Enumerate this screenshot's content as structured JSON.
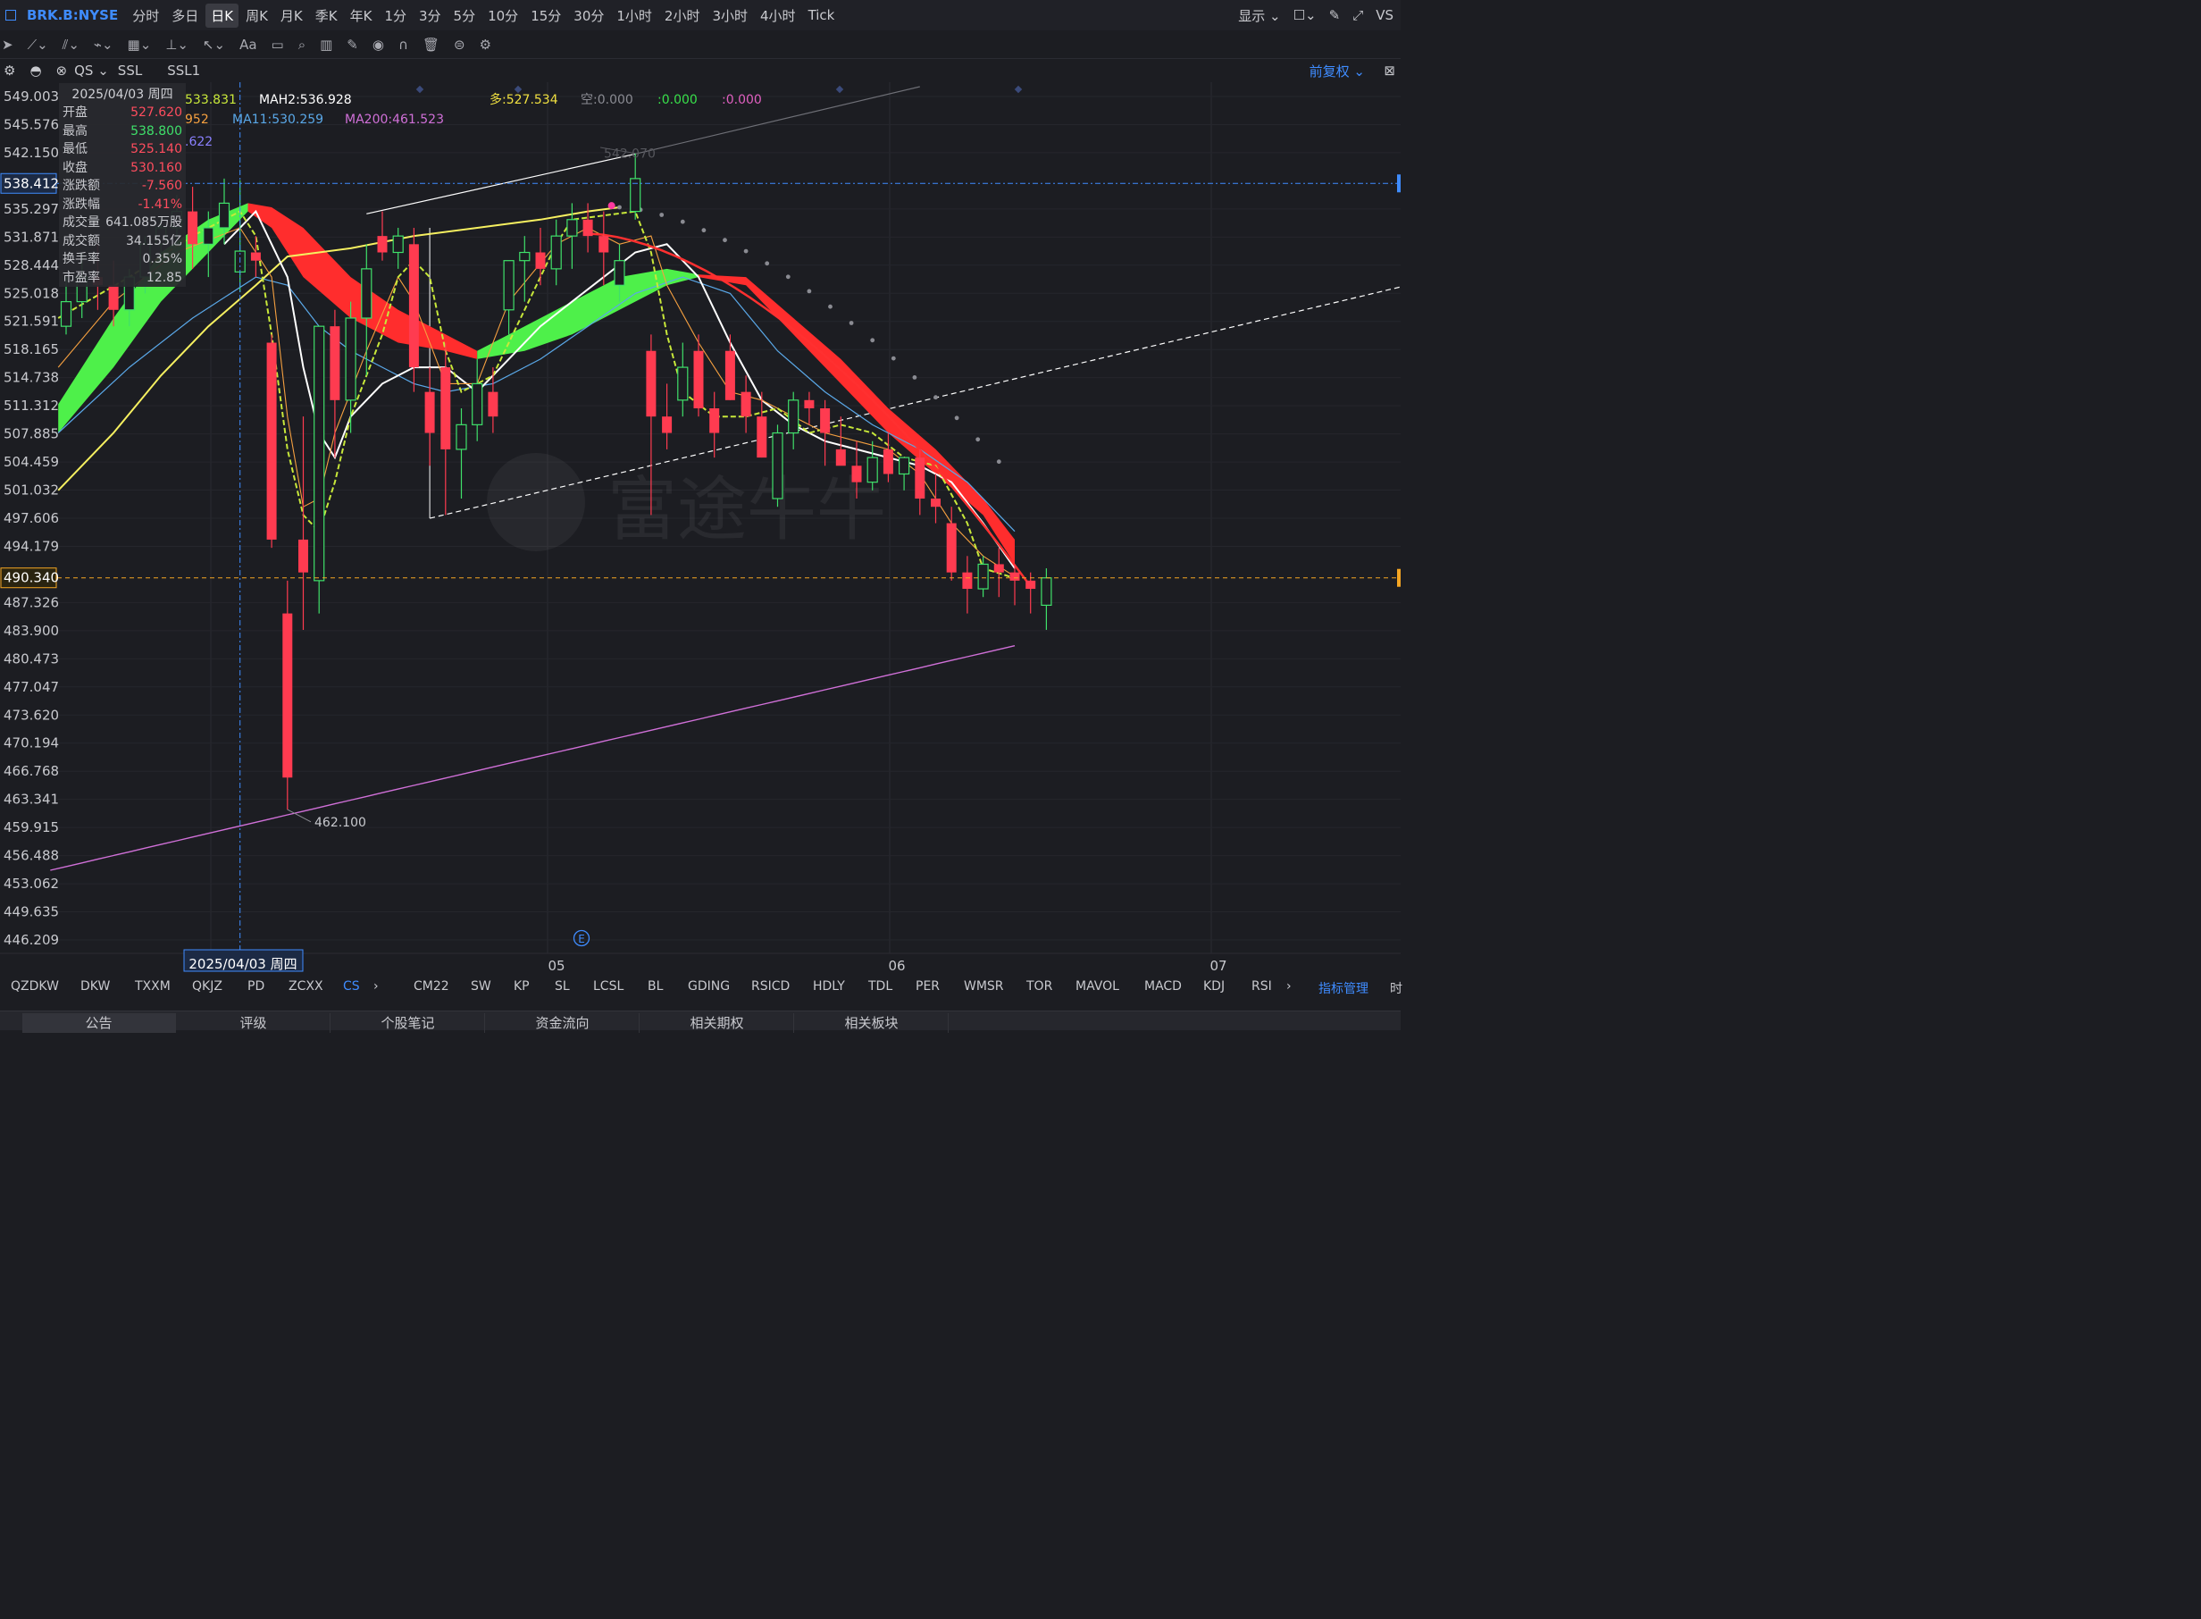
{
  "header": {
    "symbol": "BRK.B:NYSE",
    "periods": [
      "分时",
      "多日",
      "日K",
      "周K",
      "月K",
      "季K",
      "年K",
      "1分",
      "3分",
      "5分",
      "10分",
      "15分",
      "30分",
      "1小时",
      "2小时",
      "3小时",
      "4小时",
      "Tick"
    ],
    "active_period": "日K",
    "display_label": "显示",
    "vs_label": "VS"
  },
  "toolbar": {
    "text_tool": "Aa"
  },
  "indicator_bar": {
    "qs": "QS",
    "ssl": "SSL",
    "ssl1": "SSL1",
    "adjust": "前复权"
  },
  "legend": {
    "line1": [
      {
        "text": "533.831",
        "color": "#c8e83a"
      },
      {
        "text": "MAH2:536.928",
        "color": "#ffffff"
      },
      {
        "text": "多:527.534",
        "color": "#f0e040"
      },
      {
        "text": "空:0.000",
        "color": "#8a8b92"
      },
      {
        "text": ":0.000",
        "color": "#38e04a"
      },
      {
        "text": ":0.000",
        "color": "#e060c0"
      }
    ],
    "line2": [
      {
        "text": "952",
        "color": "#f5a040"
      },
      {
        "text": "MA11:530.259",
        "color": "#5aa8e8"
      },
      {
        "text": "MA200:461.523",
        "color": "#d070d8"
      }
    ],
    "line3": [
      {
        "text": ".622",
        "color": "#8a80ff"
      }
    ]
  },
  "tooltip": {
    "date": "2025/04/03 周四",
    "rows": [
      {
        "k": "开盘",
        "v": "527.620",
        "c": "#ff4d5e"
      },
      {
        "k": "最高",
        "v": "538.800",
        "c": "#3fe06a"
      },
      {
        "k": "最低",
        "v": "525.140",
        "c": "#ff4d5e"
      },
      {
        "k": "收盘",
        "v": "530.160",
        "c": "#ff4d5e"
      },
      {
        "k": "涨跌额",
        "v": "-7.560",
        "c": "#ff4d5e"
      },
      {
        "k": "涨跌幅",
        "v": "-1.41%",
        "c": "#ff4d5e"
      },
      {
        "k": "成交量",
        "v": "641.085万股",
        "c": "#c8c9ce"
      },
      {
        "k": "成交额",
        "v": "34.155亿",
        "c": "#c8c9ce"
      },
      {
        "k": "换手率",
        "v": "0.35%",
        "c": "#c8c9ce"
      },
      {
        "k": "市盈率",
        "v": "12.85",
        "c": "#c8c9ce"
      }
    ]
  },
  "colors": {
    "up": "#3fe06a",
    "down": "#ff3b50",
    "background": "#1c1d22",
    "accent": "#3f8cff"
  },
  "chart_data": {
    "type": "candlestick",
    "y_ticks": [
      "549.003",
      "545.576",
      "542.150",
      "535.297",
      "531.871",
      "528.444",
      "525.018",
      "521.591",
      "518.165",
      "514.738",
      "511.312",
      "507.885",
      "504.459",
      "501.032",
      "497.606",
      "494.179",
      "487.326",
      "483.900",
      "480.473",
      "477.047",
      "473.620",
      "470.194",
      "466.768",
      "463.341",
      "459.915",
      "456.488",
      "453.062",
      "449.635",
      "446.209"
    ],
    "ylim": [
      446.209,
      549.003
    ],
    "crosshair_price": "538.412",
    "last_price": "490.340",
    "crosshair_date": "2025/04/03 周四",
    "high_label": "542.070",
    "low_label": "462.100",
    "x_labels": [
      "05",
      "06",
      "07"
    ],
    "event_marker": "E",
    "candles": [
      [
        521,
        527,
        520,
        524
      ],
      [
        524,
        530,
        522,
        527
      ],
      [
        527,
        531,
        523,
        526
      ],
      [
        526,
        529,
        521,
        523
      ],
      [
        523,
        528,
        521,
        527
      ],
      [
        527,
        532,
        525,
        531
      ],
      [
        531,
        534,
        529,
        533
      ],
      [
        533,
        537,
        530,
        535
      ],
      [
        535,
        538,
        528,
        531
      ],
      [
        531,
        535,
        527,
        533
      ],
      [
        533,
        539,
        531,
        536
      ],
      [
        527.62,
        538.8,
        525.14,
        530.16
      ],
      [
        530,
        532,
        527,
        529
      ],
      [
        519,
        520,
        494,
        495
      ],
      [
        486,
        490,
        462.1,
        466
      ],
      [
        495,
        510,
        484,
        491
      ],
      [
        490,
        521,
        486,
        521
      ],
      [
        521,
        523,
        505,
        512
      ],
      [
        512,
        524,
        508,
        522
      ],
      [
        522,
        531,
        515,
        528
      ],
      [
        532,
        535,
        529,
        530
      ],
      [
        530,
        533,
        528,
        532
      ],
      [
        531,
        533,
        513,
        516
      ],
      [
        513,
        516,
        504,
        508
      ],
      [
        516,
        519,
        498,
        506
      ],
      [
        506,
        511,
        500,
        509
      ],
      [
        509,
        517,
        507,
        514
      ],
      [
        513,
        516,
        508,
        510
      ],
      [
        523,
        529,
        520,
        529
      ],
      [
        529,
        532,
        524,
        530
      ],
      [
        530,
        533,
        526,
        528
      ],
      [
        528,
        534,
        526,
        532
      ],
      [
        532,
        536,
        528,
        534
      ],
      [
        534,
        536,
        530,
        532
      ],
      [
        532,
        535,
        526,
        530
      ],
      [
        526,
        531,
        524,
        529
      ],
      [
        535,
        542.07,
        534,
        539
      ],
      [
        518,
        520,
        498,
        510
      ],
      [
        510,
        514,
        506,
        508
      ],
      [
        512,
        519,
        510,
        516
      ],
      [
        518,
        520,
        510,
        511
      ],
      [
        511,
        513,
        505,
        508
      ],
      [
        518,
        520,
        512,
        512
      ],
      [
        513,
        515,
        508,
        510
      ],
      [
        510,
        513,
        505,
        505
      ],
      [
        500,
        509,
        499,
        508
      ],
      [
        508,
        513,
        506,
        512
      ],
      [
        512,
        513,
        509,
        511
      ],
      [
        511,
        512,
        504,
        508
      ],
      [
        506,
        510,
        505,
        504
      ],
      [
        504,
        507,
        500,
        502
      ],
      [
        502,
        507,
        501,
        505
      ],
      [
        506,
        508,
        502,
        503
      ],
      [
        503,
        505,
        501,
        505
      ],
      [
        505,
        506,
        498,
        500
      ],
      [
        500,
        503,
        497,
        499
      ],
      [
        497,
        499,
        490,
        491
      ],
      [
        491,
        493,
        486,
        489
      ],
      [
        489,
        493,
        488,
        492
      ],
      [
        492,
        494,
        488,
        491
      ],
      [
        491,
        492,
        487,
        490
      ],
      [
        490,
        491,
        486,
        489
      ],
      [
        487,
        491.5,
        484,
        490.34
      ]
    ]
  },
  "indicator_tabs_left": [
    "QZDKW",
    "DKW",
    "TXXM",
    "QKJZ",
    "PD",
    "ZCXX",
    "CS"
  ],
  "indicator_tabs_right": [
    "CM22",
    "SW",
    "KP",
    "SL",
    "LCSL",
    "BL",
    "GDING",
    "RSICD",
    "HDLY",
    "TDL",
    "PER",
    "WMSR",
    "TOR",
    "MAVOL",
    "MACD",
    "KDJ",
    "RSI"
  ],
  "indicator_manage": "指标管理",
  "indicator_tail": "时",
  "bottom_tabs": [
    "公告",
    "评级",
    "个股笔记",
    "资金流向",
    "相关期权",
    "相关板块"
  ]
}
